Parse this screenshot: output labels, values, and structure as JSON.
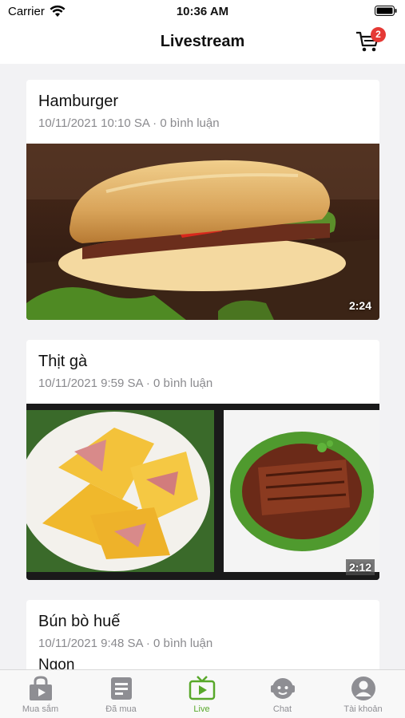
{
  "status_bar": {
    "carrier": "Carrier",
    "time": "10:36 AM"
  },
  "header": {
    "title": "Livestream",
    "cart_count": "2"
  },
  "feed": [
    {
      "title": "Hamburger",
      "meta": "10/11/2021 10:10 SA · 0 bình luận",
      "duration": "2:24"
    },
    {
      "title": "Thịt gà",
      "meta": "10/11/2021 9:59 SA · 0 bình luận",
      "duration": "2:12"
    },
    {
      "title": "Bún bò huế",
      "meta": "10/11/2021 9:48 SA · 0 bình luận",
      "subtitle": "Ngon"
    }
  ],
  "tabs": [
    {
      "label": "Mua sắm",
      "icon": "shopping-bag-icon"
    },
    {
      "label": "Đã mua",
      "icon": "purchased-list-icon"
    },
    {
      "label": "Live",
      "icon": "live-tv-icon",
      "active": true
    },
    {
      "label": "Chat",
      "icon": "chat-face-icon"
    },
    {
      "label": "Tài khoản",
      "icon": "account-icon"
    }
  ],
  "colors": {
    "accent": "#58a82a",
    "badge": "#e53935",
    "inactive": "#8e8e93"
  }
}
